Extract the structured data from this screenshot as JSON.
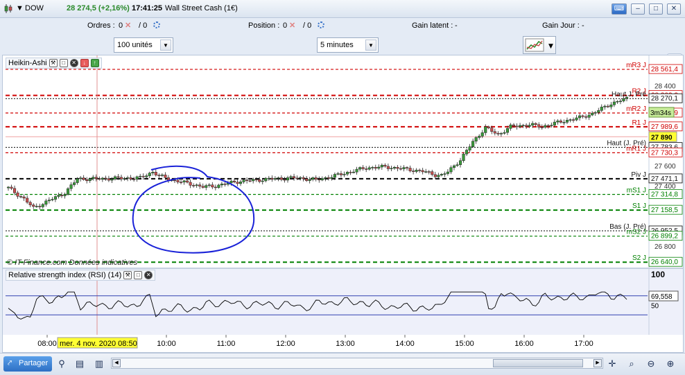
{
  "title_bar": {
    "symbol": "DOW",
    "price_change": "28 274,5 (+2,16%)",
    "time": "17:41:25",
    "instrument_name": "Wall Street Cash (1€)",
    "keyboard_icon": "keyboard-icon",
    "minimize_icon": "minimize-icon",
    "maximize_icon": "maximize-icon",
    "close_icon": "close-icon"
  },
  "toolbar": {
    "orders_label": "Ordres :",
    "orders_value_1": "0",
    "orders_value_2": "/ 0",
    "position_label": "Position :",
    "position_value_1": "0",
    "position_value_2": "/ 0",
    "latent_gain_label": "Gain latent :",
    "latent_gain_value": "-",
    "daily_gain_label": "Gain Jour :",
    "daily_gain_value": "-",
    "units_select": "100 unités",
    "interval_select": "5 minutes"
  },
  "chart_panel": {
    "title": "Heikin-Ashi",
    "footnote": "© IT-Finance.com  Données indicatives",
    "rsi_title": "Relative strength index (RSI) (14)"
  },
  "bottom_bar": {
    "share_label": "Partager"
  },
  "colors": {
    "up_candle": "#3a9a3a",
    "down_candle": "#c85050",
    "resistance": "#d00000",
    "support": "#008000",
    "pivot": "#000000",
    "rsi_line": "#000000",
    "annotation": "#1a22d8",
    "badge_yellow": "#ffff33"
  },
  "chart_data": {
    "type": "candlestick",
    "title": "Heikin-Ashi",
    "x_ticks": [
      "08:00",
      "10:00",
      "11:00",
      "12:00",
      "13:00",
      "14:00",
      "15:00",
      "16:00",
      "17:00"
    ],
    "crosshair_label": "mer. 4 nov. 2020 08:50",
    "y_ticks": [
      28400,
      28000,
      27600,
      27400,
      26800
    ],
    "ylim": [
      26600,
      28700
    ],
    "levels": [
      {
        "label": "mR3 J",
        "value": 28561.4,
        "value_text": "28 561,4",
        "kind": "resistance",
        "style": "dashed"
      },
      {
        "label": "R2 J",
        "value": 28302,
        "value_text": "28 302,2",
        "kind": "resistance",
        "style": "dashed"
      },
      {
        "label": "Haut J, Pré",
        "value": 28270.1,
        "value_text": "28 270,1",
        "kind": "reference",
        "style": "dotted"
      },
      {
        "label": "mR2 J",
        "value": 28126.9,
        "value_text": "28 126,9",
        "kind": "resistance",
        "style": "dashed"
      },
      {
        "label": "R1 J",
        "value": 27989.6,
        "value_text": "27 989,6",
        "kind": "resistance",
        "style": "dashed"
      },
      {
        "label": "Haut (J. Pré)",
        "value": 27783.6,
        "value_text": "27 783,6",
        "kind": "reference",
        "style": "dotted"
      },
      {
        "label": "mR1 J",
        "value": 27730.3,
        "value_text": "27 730,3",
        "kind": "resistance",
        "style": "dashed"
      },
      {
        "label": "Piv J",
        "value": 27471.1,
        "value_text": "27 471,1",
        "kind": "pivot",
        "style": "dashed"
      },
      {
        "label": "mS1 J",
        "value": 27314.8,
        "value_text": "27 314,8",
        "kind": "support",
        "style": "dashed"
      },
      {
        "label": "S1 J",
        "value": 27158.5,
        "value_text": "27 158,5",
        "kind": "support",
        "style": "dashed"
      },
      {
        "label": "Bas (J. Pré)",
        "value": 26952.5,
        "value_text": "26 952,5",
        "kind": "reference",
        "style": "dotted"
      },
      {
        "label": "mS2 J",
        "value": 26899.2,
        "value_text": "26 899,2",
        "kind": "support",
        "style": "dashed"
      },
      {
        "label": "S2 J",
        "value": 26640,
        "value_text": "26 640,0",
        "kind": "support",
        "style": "dashed"
      }
    ],
    "current_price_badge": {
      "value": 27890,
      "value_text": "27 890"
    },
    "countdown_badge": "3m34s",
    "rsi": {
      "name": "Relative strength index (RSI) (14)",
      "last_value": 69.558,
      "last_value_text": "69,558",
      "ticks": [
        100,
        50
      ],
      "ylim": [
        0,
        100
      ]
    }
  }
}
